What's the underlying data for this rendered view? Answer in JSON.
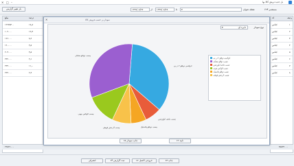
{
  "window": {
    "title": "بل جدید ترینق کالا بها"
  },
  "toolbar": {
    "cancel_label": "باز تغییر گزارش",
    "title_label": "مستعمر ۶۲۴",
    "unit_label": "نقطه عنوان",
    "date_from": "۱۳۹۷/۰۸/۲۷",
    "date_to": "۱۳۹۷/۰۸/۲۸",
    "from_label": "از",
    "to_label": "تا"
  },
  "left_grid": {
    "header": [
      "مبلغ",
      "درصد"
    ],
    "rows": [
      [
        "۱۲۹۲۵۳۰۰",
        "۱۷٫۸"
      ],
      [
        "۱۰۲۰۰۰",
        "۱۲٫۳"
      ],
      [
        "۱۶۶۰۰۰",
        "۸٫۲"
      ],
      [
        "۱۹۰۰۰۰",
        "۴٫۵"
      ],
      [
        "۲۰۴۰۰۰",
        "۴٫۵"
      ],
      [
        "۲۲۲۰۰۰",
        "۲٫۱"
      ],
      [
        "۲۲۴۰۰۰",
        "۱۱٫۰"
      ],
      [
        "۲۲۴۰۰۰",
        "۲٫۳"
      ]
    ]
  },
  "right_grid": {
    "header": [
      "ردیف",
      "کد"
    ],
    "rows": [
      [
        "۱",
        "اجناس"
      ],
      [
        "۲",
        "اجناس"
      ],
      [
        "۳",
        "اجناس"
      ],
      [
        "۴",
        "اجناس"
      ],
      [
        "۵",
        "اجناس"
      ],
      [
        "۶",
        "اجناس"
      ],
      [
        "۷",
        "اجناس"
      ],
      [
        "۸",
        "اجناس"
      ]
    ]
  },
  "middle_list": [
    "ادوکسی دوقلو ۲ در یی",
    "چسب دوقلو مشکی",
    "چسب ماهی ابلوزچمن",
    "چسب الوکس چوبی",
    "چسب دوقلو پلاستیک",
    "چسب آذرخش قوطی"
  ],
  "modal": {
    "title": "نمودار بر حسب فروش کالا",
    "chart_type_label": "نوع نمودار",
    "chart_type_value": "دایره ای",
    "close_label": "✕",
    "ok_label": "۶۲ تایید",
    "print_label": "۶۵ چاپ نمودار"
  },
  "chart_data": {
    "type": "pie",
    "title": "",
    "slices": [
      {
        "label": "ادوکسی دوقلو ۲ در یی",
        "value": 34.0,
        "color": "#36a9e1"
      },
      {
        "label": "چسب ماهی ابلوزچمن",
        "value": 6.5,
        "color": "#e85c3a"
      },
      {
        "label": "چسب دوقلو پلاستیک",
        "value": 6.0,
        "color": "#f5a623"
      },
      {
        "label": "چسب آذرخش قوطی",
        "value": 7.5,
        "color": "#f8c24a"
      },
      {
        "label": "چسب الوکس چوبی",
        "value": 12.0,
        "color": "#9ac91e"
      },
      {
        "label": "چسب دوقلو مشکی",
        "value": 31.0,
        "color": "#9b5fd0"
      }
    ],
    "legend": [
      "ادوکسی دوقلو ۲ در یی",
      "چسب دوقلو مشکی",
      "چسب ماهی ابلوزچمن",
      "چسب الوکس چوبی",
      "چسب دوقلو پلاستیک",
      "چسب آذرخش قوطی"
    ],
    "legend_position": "right"
  },
  "totals": {
    "left_total": "۲۲۵۲۶۰۰۰",
    "right_total": "۲۵۵۲۴۰۰۰"
  },
  "footer": {
    "buttons": [
      "انصراف",
      "۶۴ ثبت گزارش",
      "۶۶ خروجی اکسل",
      "۶۳ چاپ"
    ]
  },
  "icons": {
    "close": "close-icon",
    "app": "app-icon",
    "chart": "chart-icon"
  }
}
